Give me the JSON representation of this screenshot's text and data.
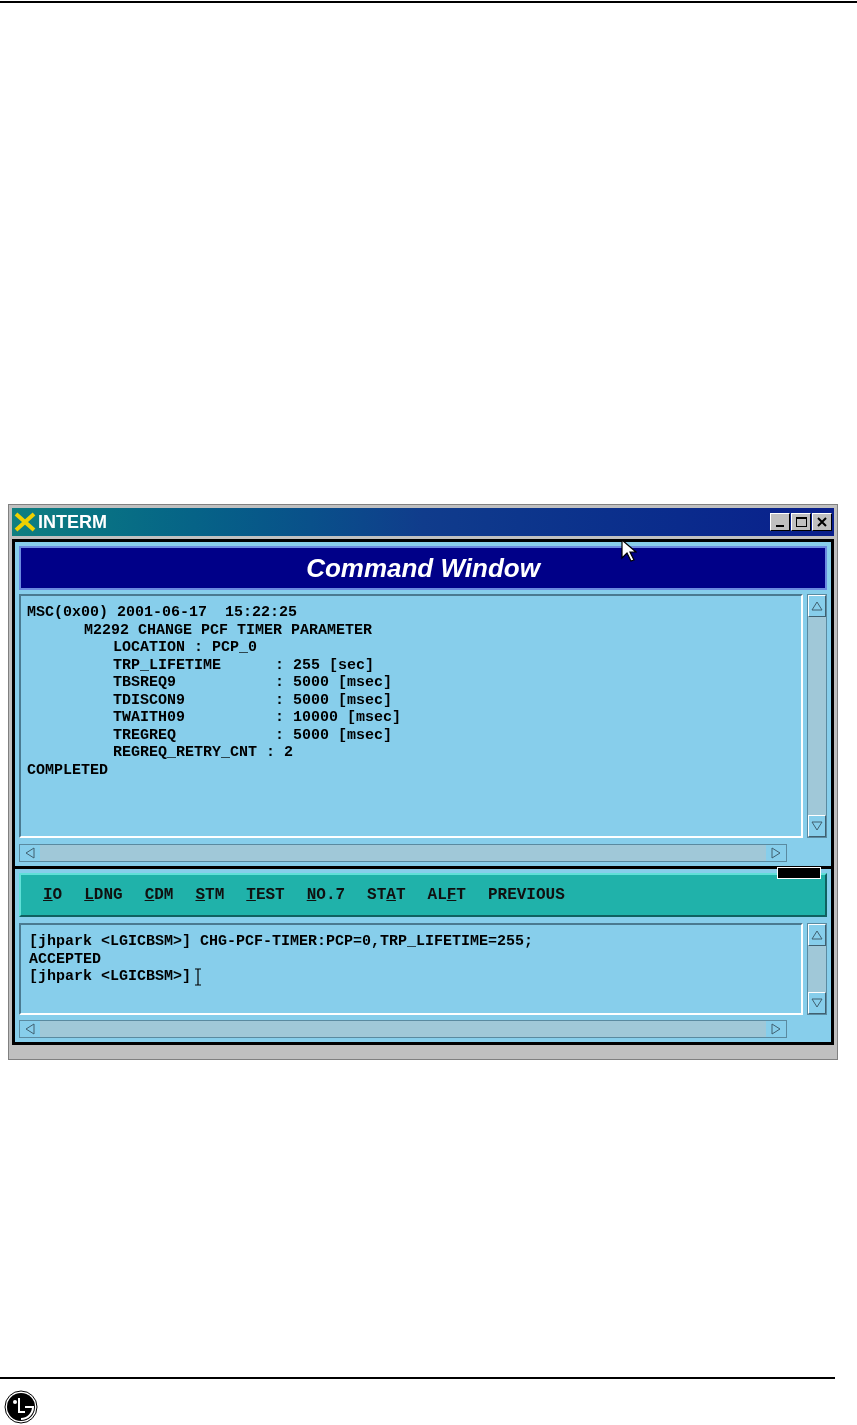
{
  "window": {
    "title": "INTERM"
  },
  "command_header": {
    "title": "Command Window"
  },
  "output": {
    "header": "MSC(0x00) 2001-06-17  15:22:25",
    "message": {
      "title": "M2292 CHANGE PCF TIMER PARAMETER",
      "children": [
        "LOCATION : PCP_0",
        "TRP_LIFETIME      : 255 [sec]",
        "TBSREQ9           : 5000 [msec]",
        "TDISCON9          : 5000 [msec]",
        "TWAITH09          : 10000 [msec]",
        "TREGREQ           : 5000 [msec]",
        "REGREQ_RETRY_CNT : 2"
      ]
    },
    "footer": "COMPLETED"
  },
  "menu": [
    {
      "key": "I",
      "after": "O"
    },
    {
      "key": "L",
      "after": "DNG"
    },
    {
      "key": "C",
      "after": "DM"
    },
    {
      "key": "S",
      "after": "TM"
    },
    {
      "key": "T",
      "after": "EST"
    },
    {
      "key": "N",
      "after": "O.7"
    },
    {
      "before": "ST",
      "key": "A",
      "after": "T"
    },
    {
      "before": "AL",
      "key": "F",
      "after": "T"
    },
    {
      "before": "PREVIOUS"
    }
  ],
  "console": {
    "lines": [
      "[jhpark <LGICBSM>] CHG-PCF-TIMER:PCP=0,TRP_LIFETIME=255;",
      "ACCEPTED"
    ],
    "prompt": "[jhpark <LGICBSM>]"
  }
}
